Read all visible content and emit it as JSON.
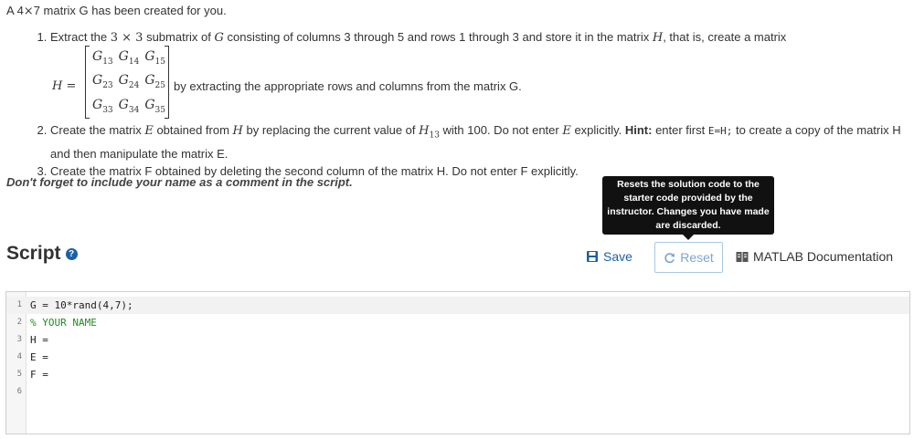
{
  "problem": {
    "intro_pre": "A 4",
    "intro_mid": "7 matrix G has been created for you.",
    "items": {
      "i1_a": "Extract the ",
      "i1_b": " submatrix of ",
      "i1_c": " consisting of columns 3 through 5 and rows 1 through 3 and store it in the matrix ",
      "i1_d": ", that is, create a matrix",
      "i1_after": "by extracting the appropriate rows and columns from the matrix G.",
      "i2_a": "Create the matrix ",
      "i2_b": " obtained from ",
      "i2_c": " by replacing  the current value of ",
      "i2_d": " with 100. Do not enter ",
      "i2_e": " explicitly. ",
      "i2_hint": "Hint:",
      "i2_f": " enter first ",
      "i2_code": "E=H;",
      "i2_g": " to create a copy of the matrix H and then manipulate the matrix E.",
      "i3": "Create the matrix F obtained by deleting the second column of the matrix H. Do not enter F explicitly."
    },
    "symbols": {
      "three_by_three": "3 × 3",
      "times": "×",
      "G": "G",
      "H": "H",
      "E": "E",
      "H13": "H",
      "H13_sub": "13",
      "H_eq": "H ="
    },
    "matrix": [
      [
        {
          "base": "G",
          "sub": "13"
        },
        {
          "base": "G",
          "sub": "14"
        },
        {
          "base": "G",
          "sub": "15"
        }
      ],
      [
        {
          "base": "G",
          "sub": "23"
        },
        {
          "base": "G",
          "sub": "24"
        },
        {
          "base": "G",
          "sub": "25"
        }
      ],
      [
        {
          "base": "G",
          "sub": "33"
        },
        {
          "base": "G",
          "sub": "34"
        },
        {
          "base": "G",
          "sub": "35"
        }
      ]
    ],
    "reminder": "Don't forget to include your name as a comment in the script."
  },
  "tooltip": "Resets the solution code to the starter code provided by the instructor. Changes you have made are discarded.",
  "script": {
    "title": "Script",
    "help_icon": "question-circle-icon",
    "save_label": "Save",
    "reset_label": "Reset",
    "doc_label": "MATLAB Documentation",
    "lines": [
      {
        "n": "1",
        "text": "G = 10*rand(4,7);",
        "type": "code"
      },
      {
        "n": "2",
        "text": "% YOUR NAME",
        "type": "comment"
      },
      {
        "n": "3",
        "text": "H =",
        "type": "code"
      },
      {
        "n": "4",
        "text": "E =",
        "type": "code"
      },
      {
        "n": "5",
        "text": "F =",
        "type": "code"
      },
      {
        "n": "6",
        "text": "",
        "type": "code"
      }
    ]
  },
  "colors": {
    "accent": "#1c5fa8",
    "comment": "#228b22",
    "tooltip_bg": "#111111"
  }
}
